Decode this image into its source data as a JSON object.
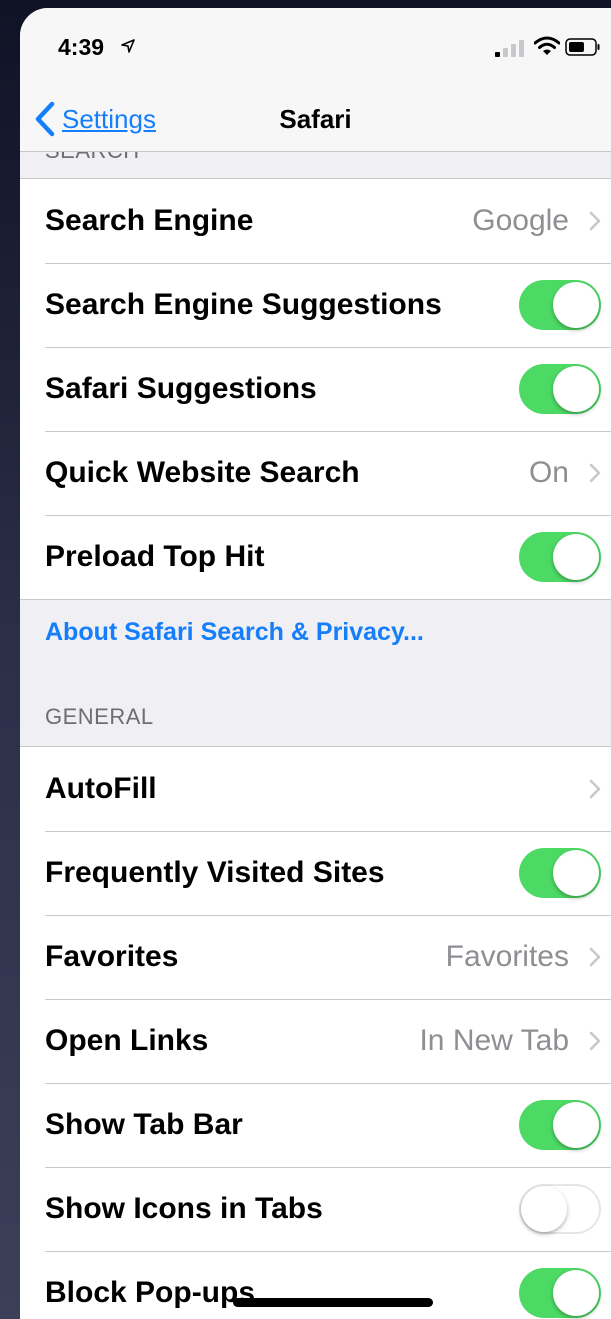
{
  "status_bar": {
    "time": "4:39"
  },
  "nav": {
    "back_label": "Settings",
    "title": "Safari"
  },
  "search_section": {
    "header": "SEARCH",
    "rows": [
      {
        "label": "Search Engine",
        "value": "Google",
        "chevron": true
      },
      {
        "label": "Search Engine Suggestions",
        "toggle": true
      },
      {
        "label": "Safari Suggestions",
        "toggle": true
      },
      {
        "label": "Quick Website Search",
        "value": "On",
        "chevron": true
      },
      {
        "label": "Preload Top Hit",
        "toggle": true
      }
    ],
    "footer_link": "About Safari Search & Privacy..."
  },
  "general_section": {
    "header": "GENERAL",
    "rows": [
      {
        "label": "AutoFill",
        "chevron": true
      },
      {
        "label": "Frequently Visited Sites",
        "toggle": true
      },
      {
        "label": "Favorites",
        "value": "Favorites",
        "chevron": true
      },
      {
        "label": "Open Links",
        "value": "In New Tab",
        "chevron": true
      },
      {
        "label": "Show Tab Bar",
        "toggle": true
      },
      {
        "label": "Show Icons in Tabs",
        "toggle": false
      },
      {
        "label": "Block Pop-ups",
        "toggle": true
      }
    ]
  },
  "colors": {
    "accent": "#147efb",
    "toggle_on": "#4cd964",
    "background": "#efeff4"
  },
  "icons": [
    "location-arrow-icon",
    "signal-icon",
    "wifi-icon",
    "battery-icon",
    "back-chevron-icon",
    "chevron-right-icon"
  ]
}
